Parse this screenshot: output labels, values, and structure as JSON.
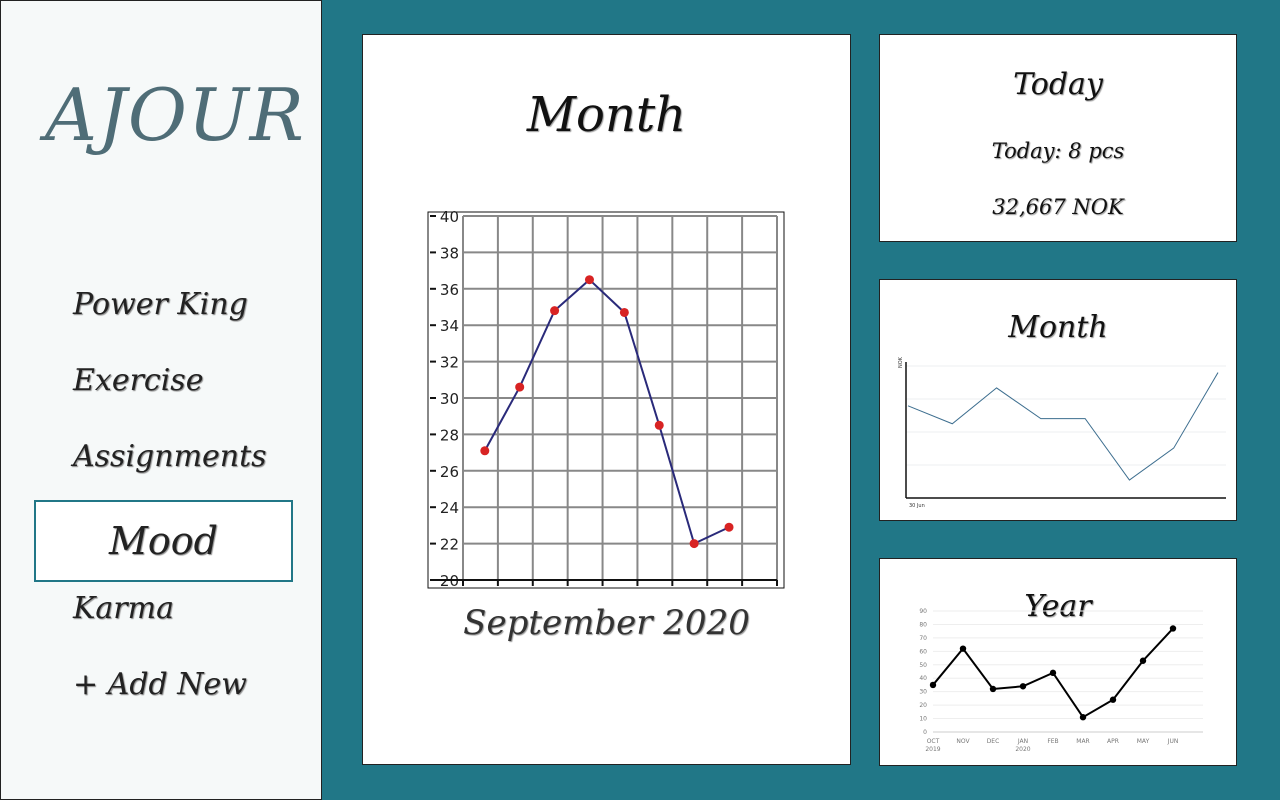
{
  "app": {
    "logo": "AJOUR"
  },
  "sidebar": {
    "items": [
      {
        "label": "Power King"
      },
      {
        "label": "Exercise"
      },
      {
        "label": "Assignments"
      },
      {
        "label": "Mood",
        "active": true
      },
      {
        "label": "Karma"
      },
      {
        "label": "+ Add New"
      }
    ]
  },
  "main": {
    "title": "Month",
    "caption": "September 2020"
  },
  "today_card": {
    "title": "Today",
    "count_line": "Today: 8 pcs",
    "amount_line": "32,667 NOK"
  },
  "month_card": {
    "title": "Month"
  },
  "year_card": {
    "title": "Year"
  },
  "chart_data": [
    {
      "type": "line",
      "x": [
        1,
        2,
        3,
        4,
        5,
        6,
        7,
        8
      ],
      "values": [
        27.1,
        30.6,
        34.8,
        36.5,
        34.7,
        28.5,
        22.0,
        22.9
      ],
      "yticks": [
        20,
        22,
        24,
        26,
        28,
        30,
        32,
        34,
        36,
        38,
        40
      ],
      "ylim": [
        20,
        40
      ],
      "grid": true,
      "colors": {
        "line": "#2a2a7a",
        "point": "#d82323"
      }
    },
    {
      "type": "line",
      "ylabel": "NOK",
      "xlabel": "30 Jun",
      "values": [
        0.72,
        0.58,
        0.86,
        0.62,
        0.62,
        0.14,
        0.39,
        0.98
      ],
      "ylim": [
        0,
        1
      ],
      "grid": true,
      "colors": {
        "line": "#3d6e8f"
      }
    },
    {
      "type": "line",
      "categories": [
        "OCT",
        "NOV",
        "DEC",
        "JAN",
        "FEB",
        "MAR",
        "APR",
        "MAY",
        "JUN"
      ],
      "year_labels": [
        "2019",
        "2020"
      ],
      "values": [
        35,
        62,
        32,
        34,
        44,
        11,
        24,
        53,
        77
      ],
      "yticks": [
        0,
        10,
        20,
        30,
        40,
        50,
        60,
        70,
        80,
        90
      ],
      "ylim": [
        0,
        90
      ],
      "grid": true,
      "colors": {
        "line": "#000000",
        "point": "#000000"
      }
    }
  ]
}
